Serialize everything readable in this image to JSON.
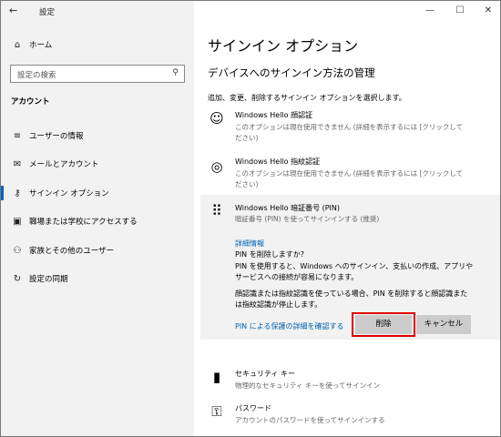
{
  "titlebar": {
    "back_glyph": "←",
    "title": "設定",
    "minimize": "—",
    "maximize": "☐",
    "close": "✕"
  },
  "sidebar": {
    "home": {
      "icon": "home-icon",
      "glyph": "⌂",
      "label": "ホーム"
    },
    "search": {
      "placeholder": "設定の検索",
      "icon": "search-icon",
      "glyph": "⚲"
    },
    "section": "アカウント",
    "items": [
      {
        "icon": "user-info-icon",
        "glyph": "≡",
        "label": "ユーザーの情報"
      },
      {
        "icon": "mail-icon",
        "glyph": "✉",
        "label": "メールとアカウント"
      },
      {
        "icon": "key-icon",
        "glyph": "⚷",
        "label": "サインイン オプション",
        "selected": true
      },
      {
        "icon": "briefcase-icon",
        "glyph": "▣",
        "label": "職場または学校にアクセスする"
      },
      {
        "icon": "family-icon",
        "glyph": "⚇",
        "label": "家族とその他のユーザー"
      },
      {
        "icon": "sync-icon",
        "glyph": "↻",
        "label": "設定の同期"
      }
    ]
  },
  "main": {
    "title": "サインイン オプション",
    "subtitle": "デバイスへのサインイン方法の管理",
    "intro": "追加、変更、削除するサインイン オプションを選択します。",
    "face": {
      "icon": "face-icon",
      "glyph": "☺",
      "title": "Windows Hello 顔認証",
      "desc_line1": "このオプションは現在使用できません (詳細を表示するには [クリックして",
      "desc_line2": "ださい)"
    },
    "fingerprint": {
      "icon": "fingerprint-icon",
      "glyph": "◎",
      "title": "Windows Hello 指紋認証",
      "desc_line1": "このオプションは現在使用できません (詳細を表示するには [クリックして",
      "desc_line2": "ださい)"
    },
    "pin": {
      "icon": "pin-keypad-icon",
      "glyph": "⠿",
      "title": "Windows Hello 暗証番号 (PIN)",
      "desc": "暗証番号 (PIN) を使ってサインインする (推奨)",
      "details_link": "詳細情報",
      "question": "PIN を削除しますか?",
      "warn_line1": "PIN を使用すると、Windows へのサインイン、支払いの作成、アプリや",
      "warn_line2": "サービスへの接続が容易になります。",
      "note_line1": "顔認識または指紋認識を使っている場合、PIN を削除すると顔認識また",
      "note_line2": "は指紋認識が停止します。",
      "protect_link": "PIN による保護の詳細を確認する",
      "delete_label": "削除",
      "cancel_label": "キャンセル"
    },
    "security_key": {
      "icon": "usb-key-icon",
      "glyph": "▮",
      "title": "セキュリティ キー",
      "desc": "物理的なセキュリティ キーを使ってサインイン"
    },
    "password": {
      "icon": "password-key-icon",
      "glyph": "⚿",
      "title": "パスワード",
      "desc": "アカウントのパスワードを使ってサインインする"
    }
  },
  "colors": {
    "accent": "#0067c0",
    "link": "#0063b1",
    "highlight_border": "#e00000",
    "sidebar_bg": "#f2f2f2"
  }
}
